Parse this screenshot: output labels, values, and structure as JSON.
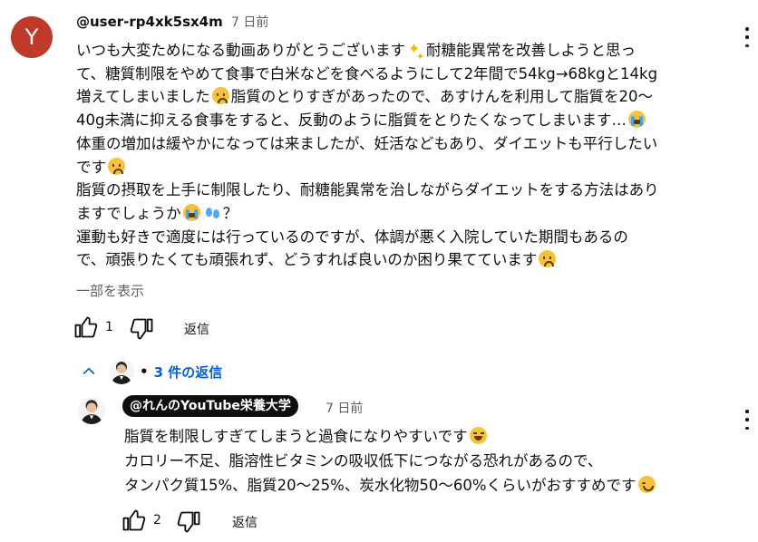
{
  "comment": {
    "avatar_letter": "Y",
    "avatar_color": "#c0392b",
    "handle": "@user-rp4xk5sx4m",
    "time": "7 日前",
    "lines": [
      "いつも大変ためになる動画ありがとうございます",
      "耐糖能異常を改善しようと思っ",
      "て、糖質制限をやめて食事で白米などを食べるようにして2年間で54kg→68kgと14kg",
      "増えてしまいました",
      "脂質のとりすぎがあったので、あすけんを利用して脂質を20〜",
      "40g未満に抑える食事をすると、反動のように脂質をとりたくなってしまいます…",
      "体重の増加は緩やかになっては来ましたが、妊活などもあり、ダイエットも平行したい",
      "です",
      "脂質の摂取を上手に制限したり、耐糖能異常を治しながらダイエットをする方法はあり",
      "ますでしょうか",
      "？",
      "運動も好きで適度には行っているのですが、体調が悪く入院していた期間もあるの",
      "で、頑張りたくても頑張れず、どうすれば良いのか困り果てています"
    ],
    "show_more": "一部を表示",
    "like_count": "1",
    "reply_label": "返信"
  },
  "replies": {
    "toggle_label": "3 件の返信"
  },
  "reply": {
    "channel": "@れんのYouTube栄養大学",
    "time": "7 日前",
    "lines": [
      "脂質を制限しすぎてしまうと過食になりやすいです",
      "カロリー不足、脂溶性ビタミンの吸収低下につながる恐れがあるので、",
      "タンパク質15%、脂質20〜25%、炭水化物50〜60%くらいがおすすめです"
    ],
    "like_count": "2",
    "reply_label": "返信"
  },
  "icons": {
    "like": "thumbs-up-icon",
    "dislike": "thumbs-down-icon",
    "more": "more-vert-icon",
    "chevron": "chevron-up-icon"
  },
  "colors": {
    "link_blue": "#065fd4",
    "secondary_text": "#606060"
  }
}
